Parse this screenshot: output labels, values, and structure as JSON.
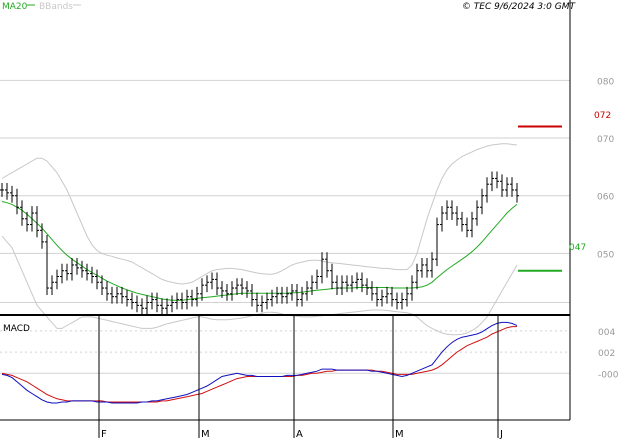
{
  "header": {
    "legend_ma": "MA20",
    "legend_bb": "BBands",
    "copyright": "© TEC 9/6/2024 3:0 GMT"
  },
  "macd_panel": {
    "label": "MACD"
  },
  "colors": {
    "price": "#000000",
    "ma": "#22aa22",
    "bbands": "#c8c8c8",
    "macd_line": "#1010c0",
    "signal_line": "#d01010",
    "resistance": "#cc0000",
    "support": "#22aa22",
    "grid": "#d2d2d2",
    "axis_text": "#999999"
  },
  "chart_data": [
    {
      "type": "ohlc",
      "panel": "price",
      "x_tick_labels": [
        "F",
        "M",
        "A",
        "M",
        "J"
      ],
      "y_tick_labels": [
        "080",
        "070",
        "060",
        "050"
      ],
      "y_ticks": [
        0.8,
        0.7,
        0.6,
        0.5
      ],
      "ylim": [
        0.395,
        0.915
      ],
      "grid": true,
      "price_closes": [
        0.61,
        0.605,
        0.6,
        0.58,
        0.56,
        0.55,
        0.57,
        0.54,
        0.52,
        0.44,
        0.45,
        0.46,
        0.47,
        0.465,
        0.48,
        0.475,
        0.47,
        0.465,
        0.46,
        0.45,
        0.44,
        0.43,
        0.425,
        0.43,
        0.425,
        0.42,
        0.415,
        0.41,
        0.405,
        0.415,
        0.42,
        0.41,
        0.405,
        0.41,
        0.415,
        0.42,
        0.415,
        0.425,
        0.42,
        0.43,
        0.445,
        0.45,
        0.455,
        0.44,
        0.435,
        0.43,
        0.44,
        0.445,
        0.44,
        0.435,
        0.42,
        0.41,
        0.415,
        0.42,
        0.425,
        0.43,
        0.425,
        0.43,
        0.435,
        0.42,
        0.43,
        0.44,
        0.45,
        0.46,
        0.49,
        0.47,
        0.45,
        0.44,
        0.45,
        0.445,
        0.45,
        0.455,
        0.445,
        0.44,
        0.43,
        0.42,
        0.425,
        0.43,
        0.42,
        0.415,
        0.42,
        0.43,
        0.45,
        0.47,
        0.48,
        0.47,
        0.49,
        0.55,
        0.57,
        0.58,
        0.57,
        0.56,
        0.55,
        0.54,
        0.56,
        0.58,
        0.6,
        0.62,
        0.63,
        0.625,
        0.61,
        0.62,
        0.61,
        0.6
      ],
      "ma20": [
        0.59,
        0.588,
        0.585,
        0.58,
        0.575,
        0.568,
        0.56,
        0.552,
        0.544,
        0.534,
        0.524,
        0.514,
        0.505,
        0.497,
        0.49,
        0.484,
        0.478,
        0.472,
        0.467,
        0.462,
        0.457,
        0.452,
        0.448,
        0.444,
        0.44,
        0.437,
        0.434,
        0.431,
        0.429,
        0.427,
        0.425,
        0.423,
        0.421,
        0.42,
        0.419,
        0.419,
        0.419,
        0.42,
        0.421,
        0.422,
        0.423,
        0.424,
        0.425,
        0.426,
        0.427,
        0.428,
        0.429,
        0.43,
        0.431,
        0.431,
        0.431,
        0.431,
        0.431,
        0.431,
        0.431,
        0.431,
        0.431,
        0.431,
        0.432,
        0.432,
        0.433,
        0.434,
        0.435,
        0.436,
        0.437,
        0.438,
        0.439,
        0.44,
        0.44,
        0.44,
        0.44,
        0.441,
        0.441,
        0.441,
        0.441,
        0.441,
        0.441,
        0.441,
        0.44,
        0.44,
        0.44,
        0.44,
        0.44,
        0.441,
        0.442,
        0.445,
        0.45,
        0.458,
        0.465,
        0.472,
        0.478,
        0.484,
        0.49,
        0.496,
        0.503,
        0.511,
        0.52,
        0.53,
        0.54,
        0.55,
        0.56,
        0.57,
        0.578,
        0.585
      ],
      "bb_upper": [
        0.63,
        0.635,
        0.64,
        0.645,
        0.65,
        0.655,
        0.66,
        0.665,
        0.665,
        0.66,
        0.65,
        0.64,
        0.625,
        0.61,
        0.59,
        0.57,
        0.55,
        0.53,
        0.515,
        0.505,
        0.5,
        0.497,
        0.495,
        0.492,
        0.49,
        0.488,
        0.485,
        0.48,
        0.475,
        0.47,
        0.465,
        0.46,
        0.455,
        0.452,
        0.45,
        0.448,
        0.447,
        0.448,
        0.45,
        0.455,
        0.46,
        0.465,
        0.47,
        0.472,
        0.473,
        0.474,
        0.474,
        0.473,
        0.472,
        0.47,
        0.468,
        0.466,
        0.465,
        0.464,
        0.464,
        0.466,
        0.47,
        0.475,
        0.48,
        0.483,
        0.485,
        0.487,
        0.488,
        0.488,
        0.487,
        0.485,
        0.484,
        0.483,
        0.482,
        0.481,
        0.48,
        0.479,
        0.478,
        0.477,
        0.476,
        0.475,
        0.474,
        0.474,
        0.473,
        0.472,
        0.472,
        0.472,
        0.48,
        0.5,
        0.53,
        0.56,
        0.585,
        0.61,
        0.63,
        0.645,
        0.655,
        0.662,
        0.668,
        0.672,
        0.676,
        0.68,
        0.683,
        0.686,
        0.688,
        0.689,
        0.69,
        0.69,
        0.689,
        0.688
      ],
      "bb_lower": [
        0.53,
        0.52,
        0.51,
        0.49,
        0.47,
        0.45,
        0.43,
        0.41,
        0.4,
        0.39,
        0.38,
        0.37,
        0.37,
        0.375,
        0.38,
        0.385,
        0.39,
        0.39,
        0.39,
        0.388,
        0.386,
        0.384,
        0.382,
        0.38,
        0.378,
        0.376,
        0.374,
        0.372,
        0.37,
        0.37,
        0.37,
        0.372,
        0.375,
        0.378,
        0.38,
        0.382,
        0.384,
        0.386,
        0.388,
        0.39,
        0.39,
        0.388,
        0.386,
        0.385,
        0.385,
        0.385,
        0.386,
        0.387,
        0.388,
        0.39,
        0.392,
        0.394,
        0.396,
        0.398,
        0.398,
        0.397,
        0.395,
        0.393,
        0.392,
        0.391,
        0.39,
        0.39,
        0.39,
        0.391,
        0.392,
        0.393,
        0.394,
        0.395,
        0.396,
        0.397,
        0.398,
        0.399,
        0.4,
        0.401,
        0.402,
        0.402,
        0.402,
        0.401,
        0.4,
        0.399,
        0.398,
        0.397,
        0.395,
        0.39,
        0.382,
        0.375,
        0.37,
        0.366,
        0.362,
        0.36,
        0.359,
        0.359,
        0.36,
        0.362,
        0.366,
        0.372,
        0.38,
        0.39,
        0.405,
        0.42,
        0.435,
        0.45,
        0.465,
        0.48
      ],
      "resistance_label": "072",
      "resistance_level": 0.72,
      "support_label": "047",
      "support_level": 0.47
    },
    {
      "type": "line",
      "panel": "macd",
      "title": "MACD",
      "y_tick_labels": [
        "004",
        "002",
        "-000"
      ],
      "y_ticks": [
        0.04,
        0.02,
        -0.0
      ],
      "ylim": [
        -0.044,
        0.054
      ],
      "series": [
        {
          "values": [
            -0.001,
            -0.002,
            -0.004,
            -0.008,
            -0.012,
            -0.016,
            -0.019,
            -0.022,
            -0.025,
            -0.027,
            -0.028,
            -0.028,
            -0.027,
            -0.027,
            -0.026,
            -0.026,
            -0.026,
            -0.026,
            -0.026,
            -0.027,
            -0.027,
            -0.027,
            -0.028,
            -0.028,
            -0.028,
            -0.028,
            -0.028,
            -0.028,
            -0.027,
            -0.027,
            -0.026,
            -0.026,
            -0.025,
            -0.024,
            -0.023,
            -0.022,
            -0.021,
            -0.02,
            -0.018,
            -0.016,
            -0.014,
            -0.012,
            -0.009,
            -0.006,
            -0.003,
            -0.002,
            -0.001,
            0.0,
            -0.001,
            -0.002,
            -0.002,
            -0.003,
            -0.003,
            -0.003,
            -0.003,
            -0.003,
            -0.003,
            -0.002,
            -0.002,
            -0.002,
            -0.001,
            0.0,
            0.001,
            0.002,
            0.004,
            0.004,
            0.004,
            0.003,
            0.003,
            0.003,
            0.003,
            0.003,
            0.003,
            0.003,
            0.002,
            0.002,
            0.001,
            0.0,
            -0.001,
            -0.002,
            -0.003,
            -0.002,
            0.0,
            0.002,
            0.004,
            0.006,
            0.008,
            0.014,
            0.02,
            0.025,
            0.029,
            0.032,
            0.034,
            0.035,
            0.036,
            0.037,
            0.039,
            0.042,
            0.045,
            0.047,
            0.048,
            0.048,
            0.047,
            0.045
          ]
        },
        {
          "values": [
            0.0,
            -0.001,
            -0.002,
            -0.004,
            -0.006,
            -0.008,
            -0.011,
            -0.014,
            -0.017,
            -0.02,
            -0.022,
            -0.024,
            -0.025,
            -0.026,
            -0.026,
            -0.026,
            -0.026,
            -0.026,
            -0.026,
            -0.026,
            -0.026,
            -0.027,
            -0.027,
            -0.027,
            -0.027,
            -0.027,
            -0.027,
            -0.027,
            -0.027,
            -0.027,
            -0.027,
            -0.027,
            -0.026,
            -0.026,
            -0.025,
            -0.024,
            -0.023,
            -0.022,
            -0.021,
            -0.02,
            -0.019,
            -0.017,
            -0.015,
            -0.013,
            -0.011,
            -0.009,
            -0.007,
            -0.005,
            -0.004,
            -0.003,
            -0.003,
            -0.003,
            -0.003,
            -0.003,
            -0.003,
            -0.003,
            -0.003,
            -0.003,
            -0.003,
            -0.002,
            -0.002,
            -0.001,
            0.0,
            0.0,
            0.001,
            0.002,
            0.002,
            0.003,
            0.003,
            0.003,
            0.003,
            0.003,
            0.003,
            0.003,
            0.003,
            0.002,
            0.002,
            0.001,
            0.0,
            -0.001,
            -0.001,
            -0.001,
            -0.001,
            0.0,
            0.001,
            0.002,
            0.003,
            0.005,
            0.008,
            0.012,
            0.016,
            0.02,
            0.023,
            0.026,
            0.028,
            0.03,
            0.032,
            0.034,
            0.037,
            0.039,
            0.041,
            0.043,
            0.044,
            0.044
          ]
        }
      ]
    }
  ]
}
